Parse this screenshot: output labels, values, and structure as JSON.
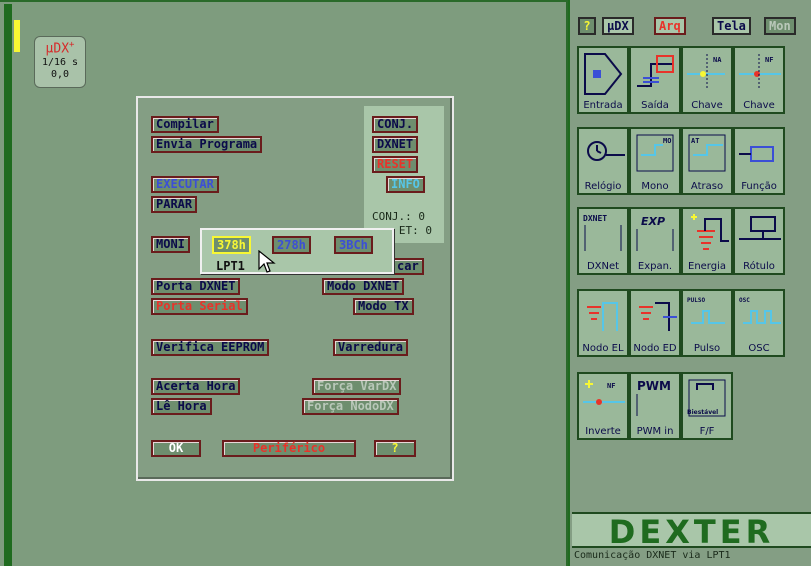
{
  "udx": {
    "title": "µDX",
    "plus": "+",
    "time": "1/16 s",
    "value": "0,0"
  },
  "dialog": {
    "compilar": "Compilar",
    "envia": "Envia Programa",
    "executar": "EXECUTAR",
    "parar": "PARAR",
    "monitor": "MONI",
    "porta_dxnet": "Porta DXNET",
    "porta_serial": "Porta Serial",
    "modo_dxnet": "Modo DXNET",
    "modo_tx": "Modo TX",
    "carregar": "car",
    "verifica": "Verifica EEPROM",
    "varredura": "Varredura",
    "acerta_hora": "Acerta Hora",
    "le_hora": "Lê Hora",
    "forca_vardx": "Força VarDX",
    "forca_nododx": "Força NodoDX",
    "ok": "OK",
    "periferico": "Periférico",
    "help": "?",
    "conj": "CONJ.",
    "dxnet": "DXNET",
    "reset": "RESET",
    "info": "INFO",
    "conj_count": "CONJ.: 0",
    "et_count": "ET: 0"
  },
  "popup": {
    "opt1": "378h",
    "opt2": "278h",
    "opt3": "3BCh",
    "selected": "LPT1"
  },
  "toolbar": {
    "help": "?",
    "udx": "µDX",
    "arq": "Arq",
    "tela": "Tela",
    "mon": "Mon"
  },
  "tiles": [
    {
      "label": "Entrada"
    },
    {
      "label": "Saída"
    },
    {
      "label": "Chave"
    },
    {
      "label": "Chave"
    },
    {
      "label": "Relógio"
    },
    {
      "label": "Mono"
    },
    {
      "label": "Atraso"
    },
    {
      "label": "Função"
    },
    {
      "label": "DXNet"
    },
    {
      "label": "Expan."
    },
    {
      "label": "Energia"
    },
    {
      "label": "Rótulo"
    },
    {
      "label": "Nodo EL"
    },
    {
      "label": "Nodo ED"
    },
    {
      "label": "Pulso"
    },
    {
      "label": "OSC"
    },
    {
      "label": "Inverte"
    },
    {
      "label": "PWM in"
    },
    {
      "label": "F/F"
    }
  ],
  "tile_icon_text": {
    "na": "NA",
    "nf": "NF",
    "mo": "MO",
    "at": "AT",
    "dxnet": "DXNET",
    "exp": "EXP",
    "pulso": "PULSO",
    "osc": "OSC",
    "pwm": "PWM",
    "biestavel": "Biestável"
  },
  "brand": "DEXTER",
  "status": "Comunicação DXNET via LPT1",
  "colors": {
    "green": "#1f6b1f",
    "red": "#e8332a",
    "navy": "#0b0b4a",
    "cursor": "#f7f734"
  }
}
